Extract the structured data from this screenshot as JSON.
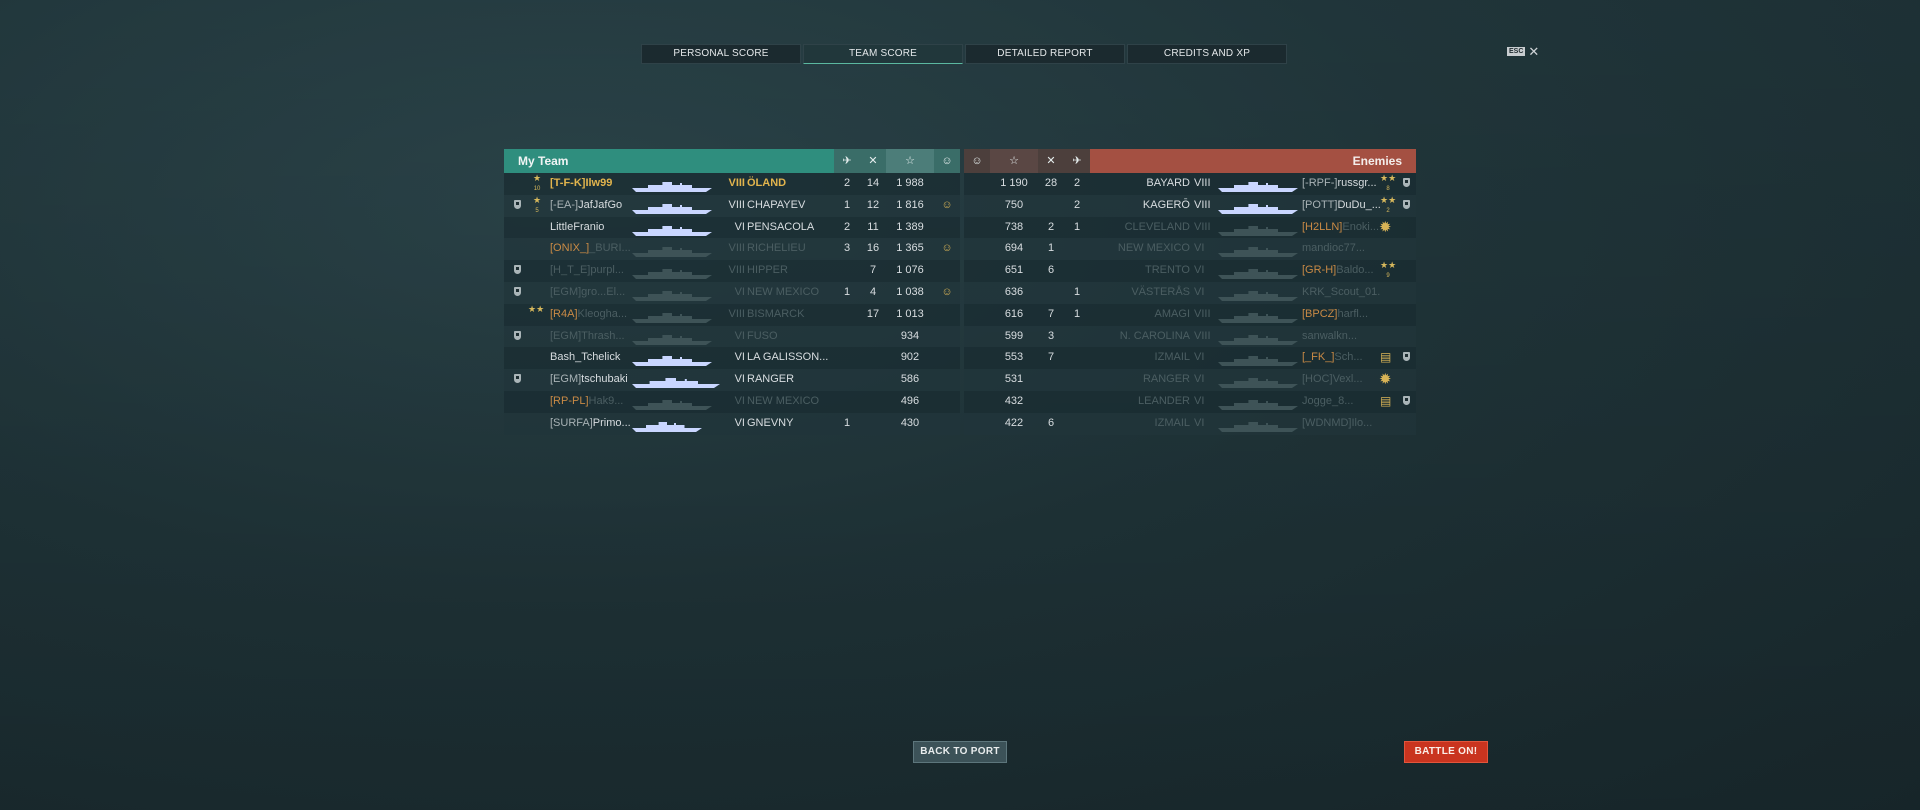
{
  "tabs": [
    {
      "label": "PERSONAL SCORE",
      "active": false
    },
    {
      "label": "TEAM SCORE",
      "active": true
    },
    {
      "label": "DETAILED REPORT",
      "active": false
    },
    {
      "label": "CREDITS AND XP",
      "active": false
    }
  ],
  "esc": {
    "key_label": "ESC",
    "close_icon": "close-icon"
  },
  "header": {
    "my_team": "My Team",
    "enemies": "Enemies",
    "icons_left": [
      "plane-kill-icon",
      "ship-kill-icon",
      "star-xp-icon",
      "smile-icon"
    ],
    "icons_right": [
      "smile-icon",
      "star-xp-icon",
      "ship-kill-icon",
      "plane-kill-icon"
    ],
    "icon_glyphs": {
      "plane": "✈",
      "kill": "✕",
      "star": "☆",
      "smile": "☺"
    },
    "colors": {
      "my_team": "#2f8e7e",
      "enemies": "#a45042"
    }
  },
  "my_team": [
    {
      "badge": false,
      "stars": 1,
      "stars_num": "10",
      "clan": "[T-F-K]",
      "name": "Ilw99",
      "tier": "VIII",
      "ship": "ÖLAND",
      "planes": "2",
      "kills": "14",
      "xp": "1 988",
      "smile": false,
      "style": "self"
    },
    {
      "badge": true,
      "stars": 1,
      "stars_num": "5",
      "clan": "[-EA-]",
      "name": "JafJafGo",
      "tier": "VIII",
      "ship": "CHAPAYEV",
      "planes": "1",
      "kills": "12",
      "xp": "1 816",
      "smile": true,
      "style": "alive"
    },
    {
      "badge": false,
      "stars": 0,
      "stars_num": "",
      "clan": "",
      "name": "LittleFranio",
      "tier": "VI",
      "ship": "PENSACOLA",
      "planes": "2",
      "kills": "11",
      "xp": "1 389",
      "smile": false,
      "style": "alive"
    },
    {
      "badge": false,
      "stars": 0,
      "stars_num": "",
      "clan": "[ONIX_]",
      "name": "_BURI...",
      "tier": "VIII",
      "ship": "RICHELIEU",
      "planes": "3",
      "kills": "16",
      "xp": "1 365",
      "smile": true,
      "style": "dead-orange"
    },
    {
      "badge": true,
      "stars": 0,
      "stars_num": "",
      "clan": "[H_T_E]",
      "name": "purpl...",
      "tier": "VIII",
      "ship": "HIPPER",
      "planes": "",
      "kills": "7",
      "xp": "1 076",
      "smile": false,
      "style": "dead"
    },
    {
      "badge": true,
      "stars": 0,
      "stars_num": "",
      "clan": "[EGM]",
      "name": "gro...El...",
      "tier": "VI",
      "ship": "NEW MEXICO",
      "planes": "1",
      "kills": "4",
      "xp": "1 038",
      "smile": true,
      "style": "dead"
    },
    {
      "badge": false,
      "stars": 2,
      "stars_num": "",
      "clan": "[R4A]",
      "name": "Kleogha...",
      "tier": "VIII",
      "ship": "BISMARCK",
      "planes": "",
      "kills": "17",
      "xp": "1 013",
      "smile": false,
      "style": "dead-orange"
    },
    {
      "badge": true,
      "stars": 0,
      "stars_num": "",
      "clan": "[EGM]",
      "name": "Thrash...",
      "tier": "VI",
      "ship": "FUSO",
      "planes": "",
      "kills": "",
      "xp": "934",
      "smile": false,
      "style": "dead"
    },
    {
      "badge": false,
      "stars": 0,
      "stars_num": "",
      "clan": "",
      "name": "Bash_Tchelick",
      "tier": "VI",
      "ship": "LA GALISSON...",
      "planes": "",
      "kills": "",
      "xp": "902",
      "smile": false,
      "style": "alive"
    },
    {
      "badge": true,
      "stars": 0,
      "stars_num": "",
      "clan": "[EGM]",
      "name": "tschubaki",
      "tier": "VI",
      "ship": "RANGER",
      "planes": "",
      "kills": "",
      "xp": "586",
      "smile": false,
      "style": "alive"
    },
    {
      "badge": false,
      "stars": 0,
      "stars_num": "",
      "clan": "[RP-PL]",
      "name": "Hak9...",
      "tier": "VI",
      "ship": "NEW MEXICO",
      "planes": "",
      "kills": "",
      "xp": "496",
      "smile": false,
      "style": "dead-orange"
    },
    {
      "badge": false,
      "stars": 0,
      "stars_num": "",
      "clan": "[SURFA]",
      "name": "Primo...",
      "tier": "VI",
      "ship": "GNEVNY",
      "planes": "1",
      "kills": "",
      "xp": "430",
      "smile": false,
      "style": "alive"
    }
  ],
  "enemies": [
    {
      "xp": "1 190",
      "kills": "28",
      "planes": "2",
      "ship": "BAYARD",
      "tier": "VIII",
      "clan": "[-RPF-]",
      "name": "russgr...",
      "deco": "stars",
      "deco_num": "8",
      "badge": true,
      "style": "alive"
    },
    {
      "xp": "750",
      "kills": "",
      "planes": "2",
      "ship": "KAGERŌ",
      "tier": "VIII",
      "clan": "[POTT]",
      "name": "DuDu_...",
      "deco": "stars",
      "deco_num": "2",
      "badge": true,
      "style": "alive"
    },
    {
      "xp": "738",
      "kills": "2",
      "planes": "1",
      "ship": "CLEVELAND",
      "tier": "VIII",
      "clan": "[H2LLN]",
      "name": "Enoki...",
      "deco": "medal",
      "deco_num": "",
      "badge": false,
      "style": "dead-orange"
    },
    {
      "xp": "694",
      "kills": "1",
      "planes": "",
      "ship": "NEW MEXICO",
      "tier": "VI",
      "clan": "",
      "name": "mandioc77...",
      "deco": "",
      "deco_num": "",
      "badge": false,
      "style": "dead"
    },
    {
      "xp": "651",
      "kills": "6",
      "planes": "",
      "ship": "TRENTO",
      "tier": "VI",
      "clan": "[GR-H]",
      "name": "Baldo...",
      "deco": "stars",
      "deco_num": "9",
      "badge": false,
      "style": "dead-orange"
    },
    {
      "xp": "636",
      "kills": "",
      "planes": "1",
      "ship": "VÄSTERÅS",
      "tier": "VI",
      "clan": "",
      "name": "KRK_Scout_01...",
      "deco": "",
      "deco_num": "",
      "badge": false,
      "style": "dead"
    },
    {
      "xp": "616",
      "kills": "7",
      "planes": "1",
      "ship": "AMAGI",
      "tier": "VIII",
      "clan": "[BPCZ]",
      "name": "harfl...",
      "deco": "",
      "deco_num": "",
      "badge": false,
      "style": "dead-orange"
    },
    {
      "xp": "599",
      "kills": "3",
      "planes": "",
      "ship": "N. CAROLINA",
      "tier": "VIII",
      "clan": "",
      "name": "sanwalkn...",
      "deco": "",
      "deco_num": "",
      "badge": false,
      "style": "dead"
    },
    {
      "xp": "553",
      "kills": "7",
      "planes": "",
      "ship": "IZMAIL",
      "tier": "VI",
      "clan": "[_FK_]",
      "name": "Sch...",
      "deco": "rank",
      "deco_num": "",
      "badge": true,
      "style": "dead-orange"
    },
    {
      "xp": "531",
      "kills": "",
      "planes": "",
      "ship": "RANGER",
      "tier": "VI",
      "clan": "[HOC]",
      "name": "Vexl...",
      "deco": "medal",
      "deco_num": "",
      "badge": false,
      "style": "dead"
    },
    {
      "xp": "432",
      "kills": "",
      "planes": "",
      "ship": "LEANDER",
      "tier": "VI",
      "clan": "",
      "name": "Jogge_8...",
      "deco": "rank",
      "deco_num": "",
      "badge": true,
      "style": "dead"
    },
    {
      "xp": "422",
      "kills": "6",
      "planes": "",
      "ship": "IZMAIL",
      "tier": "VI",
      "clan": "[WDNMD]",
      "name": "Ilo...",
      "deco": "",
      "deco_num": "",
      "badge": false,
      "style": "dead"
    }
  ],
  "buttons": {
    "back_to_port": "BACK TO PORT",
    "battle_on": "BATTLE ON!"
  }
}
